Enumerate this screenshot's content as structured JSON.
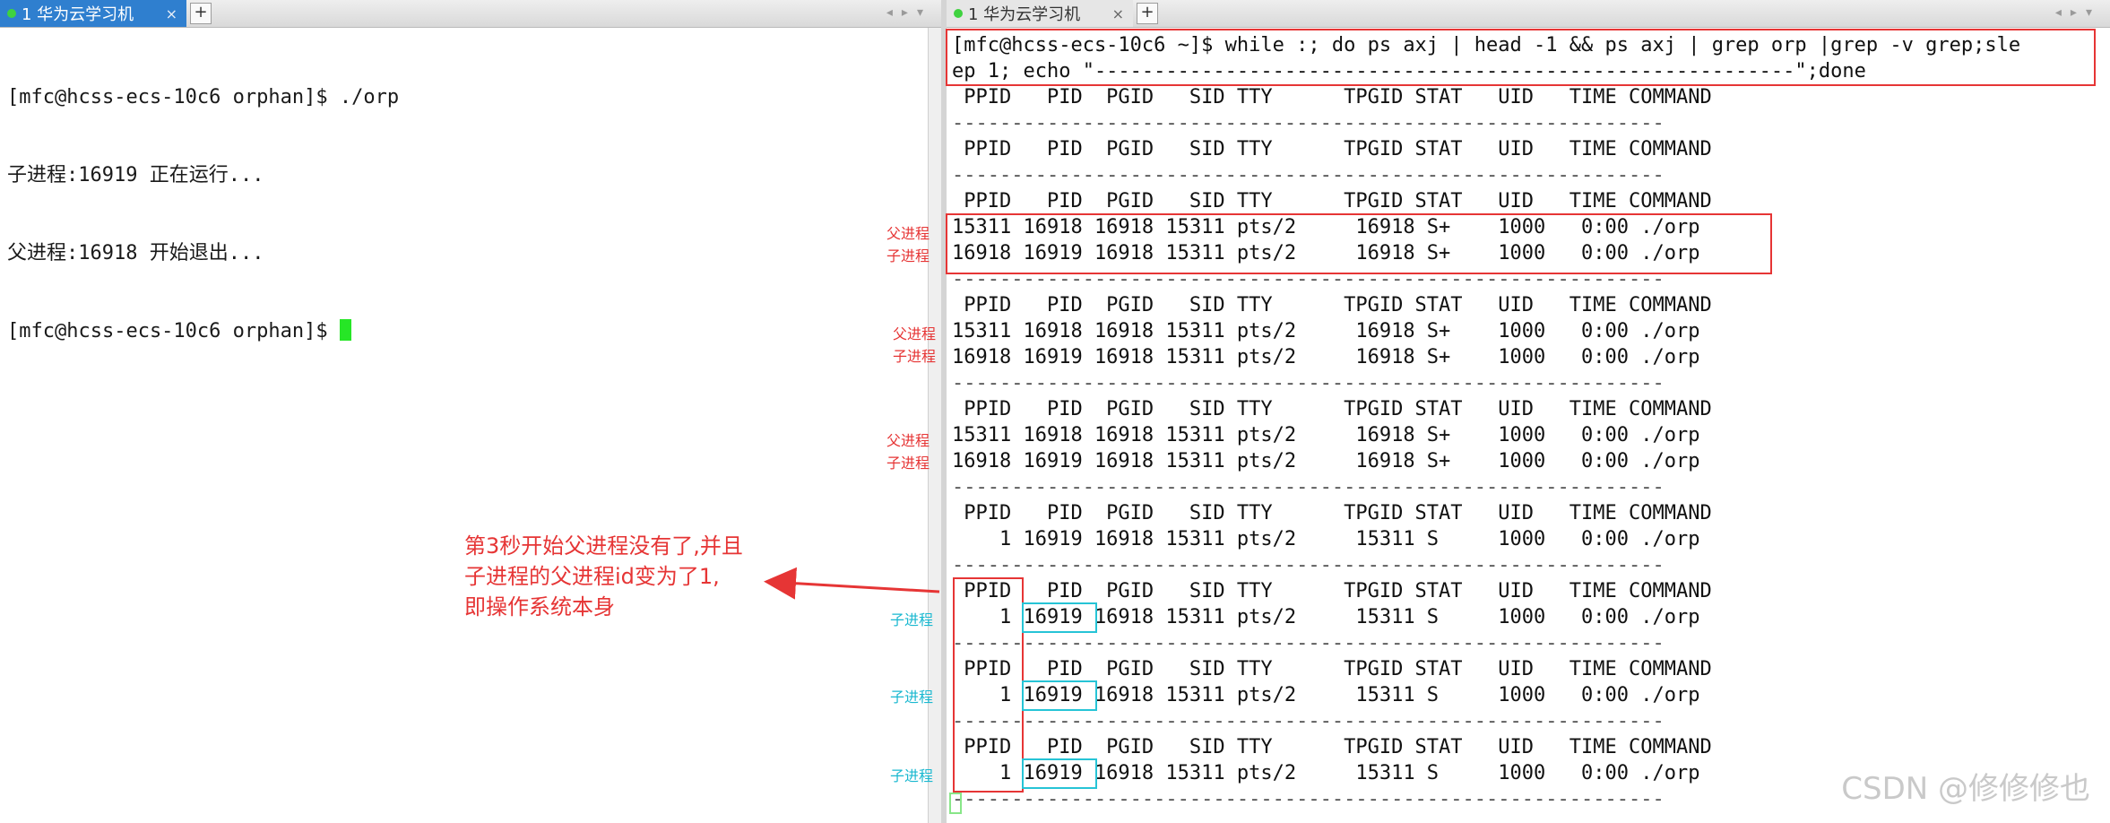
{
  "left": {
    "tab_label": "1 华为云学习机",
    "tab_close": "×",
    "plus": "+",
    "lines": [
      "[mfc@hcss-ecs-10c6 orphan]$ ./orp",
      "子进程:16919 正在运行...",
      "父进程:16918 开始退出...",
      "[mfc@hcss-ecs-10c6 orphan]$ "
    ]
  },
  "right": {
    "tab_label": "1 华为云学习机",
    "tab_close": "×",
    "plus": "+",
    "command_lines": [
      "[mfc@hcss-ecs-10c6 ~]$ while :; do ps axj | head -1 && ps axj | grep orp |grep -v grep;sle",
      "ep 1; echo \"-----------------------------------------------------------\";done"
    ],
    "header": " PPID   PID  PGID   SID TTY      TPGID STAT   UID   TIME COMMAND",
    "separator": "------------------------------------------------------------",
    "blocks": [
      {
        "rows": []
      },
      {
        "rows": []
      },
      {
        "rows": [
          "15311 16918 16918 15311 pts/2     16918 S+    1000   0:00 ./orp",
          "16918 16919 16918 15311 pts/2     16918 S+    1000   0:00 ./orp"
        ]
      },
      {
        "rows": [
          "15311 16918 16918 15311 pts/2     16918 S+    1000   0:00 ./orp",
          "16918 16919 16918 15311 pts/2     16918 S+    1000   0:00 ./orp"
        ]
      },
      {
        "rows": [
          "15311 16918 16918 15311 pts/2     16918 S+    1000   0:00 ./orp",
          "16918 16919 16918 15311 pts/2     16918 S+    1000   0:00 ./orp"
        ]
      },
      {
        "rows": [
          "    1 16919 16918 15311 pts/2     15311 S     1000   0:00 ./orp"
        ]
      },
      {
        "rows": [
          "    1 16919 16918 15311 pts/2     15311 S     1000   0:00 ./orp"
        ]
      },
      {
        "rows": [
          "    1 16919 16918 15311 pts/2     15311 S     1000   0:00 ./orp"
        ]
      },
      {
        "rows": [
          "    1 16919 16918 15311 pts/2     15311 S     1000   0:00 ./orp"
        ]
      }
    ]
  },
  "annotations": {
    "parent": "父进程",
    "child": "子进程",
    "note": "第3秒开始父进程没有了,并且\n子进程的父进程id变为了1,\n即操作系统本身"
  },
  "watermark": "CSDN @修修修也",
  "colors": {
    "annotation_red": "#e63535",
    "annotation_cyan": "#1ab8d0",
    "tab_blue": "#2f7fcf",
    "cursor_green": "#26e626"
  }
}
